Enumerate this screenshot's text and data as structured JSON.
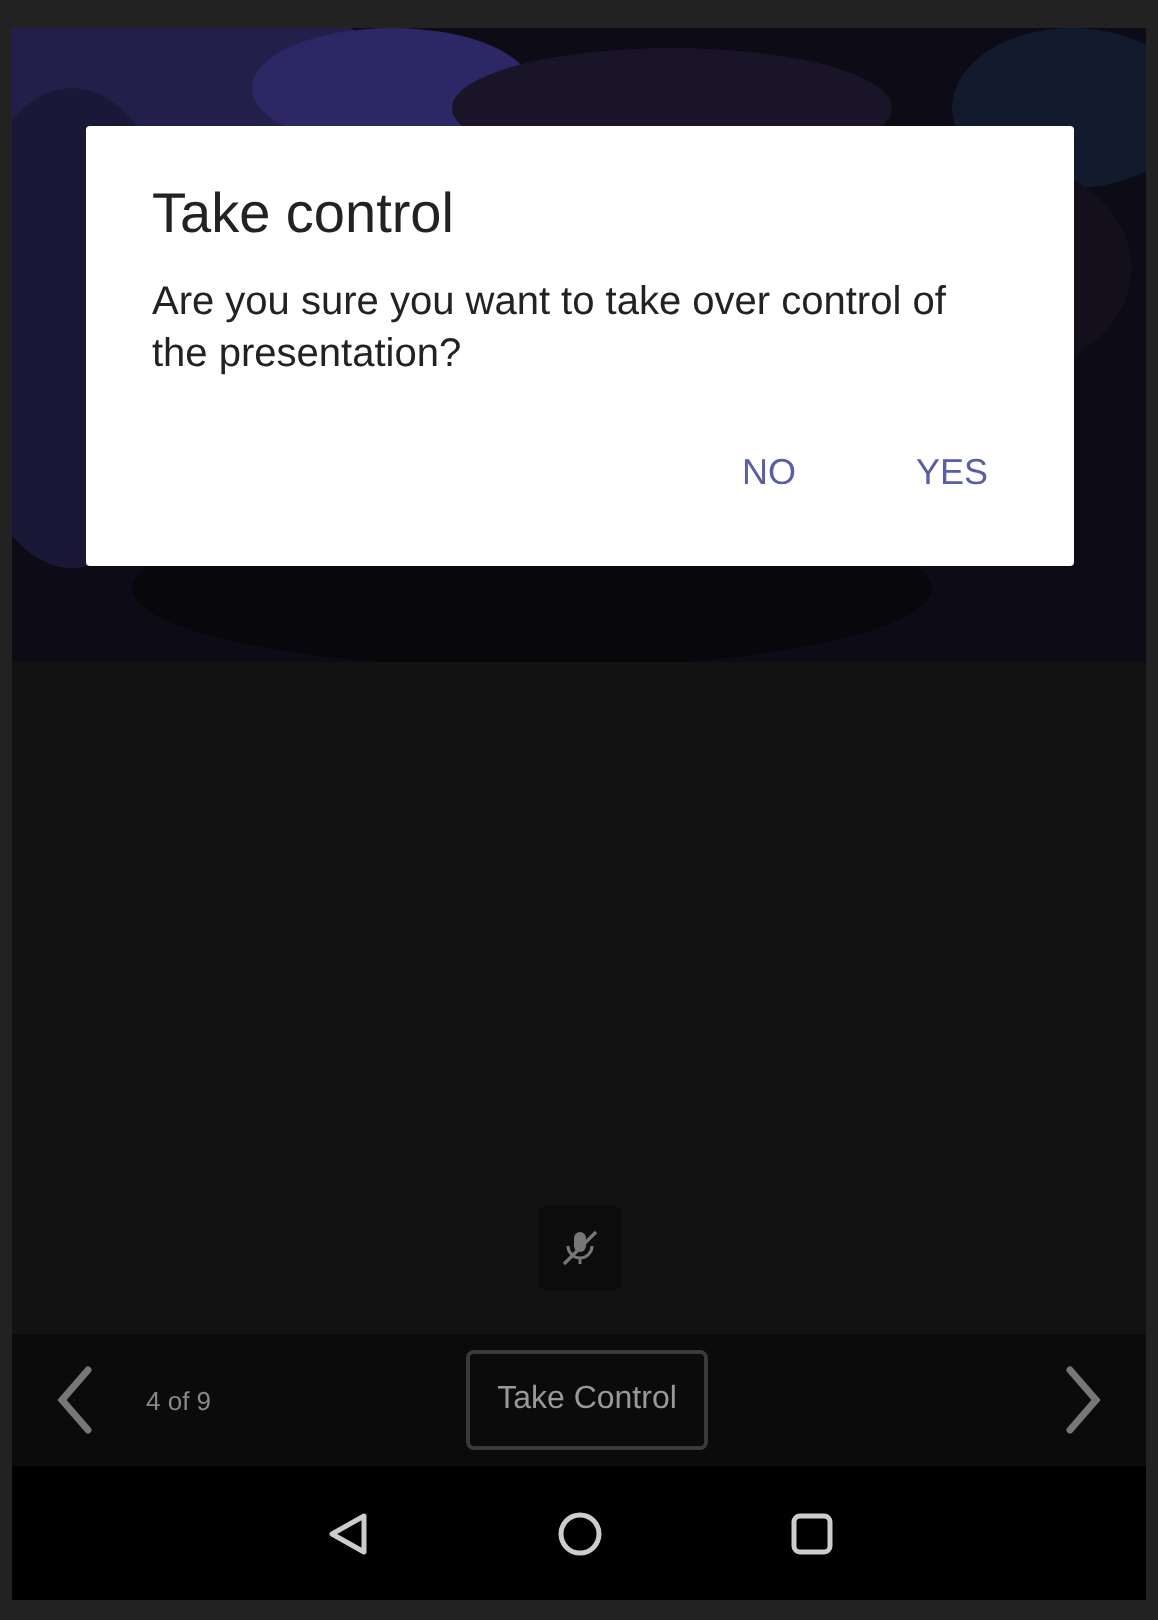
{
  "mute_button": {
    "muted": true
  },
  "toolbar": {
    "page_indicator": "4 of 9",
    "take_control_button": "Take Control"
  },
  "dialog": {
    "title": "Take control",
    "message": "Are you sure you want to take over control of the presentation?",
    "buttons": [
      "NO",
      "YES"
    ]
  }
}
